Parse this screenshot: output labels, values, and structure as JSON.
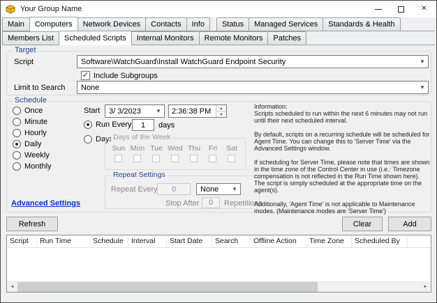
{
  "window": {
    "title": "Your Group Name"
  },
  "icons": {
    "dropdown_arrow": "▾",
    "spin_up": "▴",
    "spin_down": "▾",
    "check": "✓",
    "close": "✕",
    "scroll_left": "◄",
    "scroll_right": "►"
  },
  "tabs_primary": [
    "Main",
    "Computers",
    "Network Devices",
    "Contacts",
    "Info",
    "Status",
    "Managed Services",
    "Standards & Health"
  ],
  "tabs_secondary": [
    "Members List",
    "Scheduled Scripts",
    "Internal Monitors",
    "Remote Monitors",
    "Patches"
  ],
  "target": {
    "group_label": "Target",
    "script_label": "Script",
    "script_value": "Software\\WatchGuard\\Install WatchGuard Endpoint Security",
    "include_subgroups_label": "Include Subgroups",
    "include_subgroups_checked": true,
    "limit_label": "Limit to Search",
    "limit_value": "None"
  },
  "schedule": {
    "group_label": "Schedule",
    "frequency_options": [
      "Once",
      "Minute",
      "Hourly",
      "Daily",
      "Weekly",
      "Monthly"
    ],
    "selected_frequency": "Daily",
    "start_label": "Start",
    "start_date": "3/ 3/2023",
    "start_time": "2:36:38 PM",
    "run_every_label": "Run Every",
    "run_every_value": "1",
    "run_every_unit": "days",
    "days_option_label": "Days",
    "days_of_week": {
      "group_label": "Days of the Week",
      "days": [
        "Sun",
        "Mon",
        "Tue",
        "Wed",
        "Thu",
        "Fri",
        "Sat"
      ]
    },
    "repeat_settings": {
      "group_label": "Repeat Settings",
      "repeat_every_label": "Repeat Every",
      "repeat_every_value": "0",
      "repeat_unit_value": "None",
      "stop_after_label": "Stop After",
      "stop_after_value": "0",
      "repetitions_label": "Repetitions"
    },
    "info_text": "Information:\nScripts scheduled to run within the next 6 minutes may not run until their next scheduled interval.\n\nBy default, scripts on a recurring schedule will be scheduled for Agent Time. You can change this to 'Server Time' via the Advanced Settings window.\n\nIf scheduling for Server Time, please note that times are shown in the time zone of the Control Center in use (i.e.: Timezone compensation is not reflected in the Run Time shown here). The script is simply scheduled at the appropriate time on the agent(s).\n\nAdditionally, 'Agent Time' is not applicable to Maintenance modes. (Maintenance modes are 'Server Time')",
    "advanced_settings_label": "Advanced Settings"
  },
  "actions": {
    "refresh_label": "Refresh",
    "clear_label": "Clear",
    "add_label": "Add"
  },
  "table": {
    "columns": [
      "Script",
      "Run Time",
      "Schedule",
      "Interval",
      "Start Date",
      "Search",
      "Offline Action",
      "Time Zone",
      "Scheduled By"
    ],
    "rows": []
  }
}
